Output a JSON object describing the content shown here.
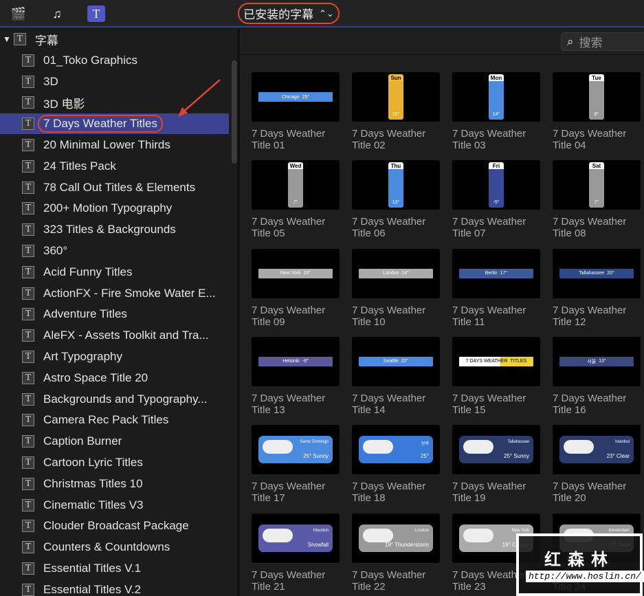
{
  "toolbar": {
    "icons": [
      "clapper-star-icon",
      "music-photo-icon",
      "titles-icon"
    ],
    "selector": "已安装的字幕",
    "selector_icon": "chevron-updown-icon"
  },
  "sidebar": {
    "root": "字幕",
    "items": [
      "01_Toko Graphics",
      "3D",
      "3D 电影",
      "7 Days Weather Titles",
      "20 Minimal Lower Thirds",
      "24 Titles Pack",
      "78 Call Out Titles & Elements",
      "200+ Motion Typography",
      "323 Titles & Backgrounds",
      "360°",
      "Acid Funny Titles",
      "ActionFX - Fire Smoke Water E...",
      "Adventure Titles",
      "AleFX - Assets Toolkit and Tra...",
      "Art Typography",
      "Astro Space Title 20",
      "Backgrounds and Typography...",
      "Camera Rec Pack Titles",
      "Caption Burner",
      "Cartoon Lyric Titles",
      "Christmas Titles 10",
      "Cinematic Titles V3",
      "Clouder Broadcast Package",
      "Counters & Countdowns",
      "Essential Titles V.1",
      "Essential Titles V.2"
    ],
    "selected_index": 3
  },
  "search": {
    "placeholder": "搜索"
  },
  "tiles": [
    {
      "l1": "7 Days Weather",
      "l2": "Title 01",
      "kind": "banner",
      "city": "Chicago",
      "temp": "25°",
      "color": "#4a8be0"
    },
    {
      "l1": "7 Days Weather",
      "l2": "Title 02",
      "kind": "vcard",
      "day": "Sun",
      "temp": "28°",
      "color": "#e8b030"
    },
    {
      "l1": "7 Days Weather",
      "l2": "Title 03",
      "kind": "vcard",
      "day": "Mon",
      "temp": "14°",
      "color": "#4a8be0"
    },
    {
      "l1": "7 Days Weather",
      "l2": "Title 04",
      "kind": "vcard",
      "day": "Tue",
      "temp": "8°",
      "color": "#999999"
    },
    {
      "l1": "7 Days Weather",
      "l2": "Title 05",
      "kind": "vcard",
      "day": "Wed",
      "temp": "7°",
      "color": "#999999"
    },
    {
      "l1": "7 Days Weather",
      "l2": "Title 06",
      "kind": "vcard",
      "day": "Thu",
      "temp": "13°",
      "color": "#4a8be0"
    },
    {
      "l1": "7 Days Weather",
      "l2": "Title 07",
      "kind": "vcard",
      "day": "Fri",
      "temp": "-5°",
      "color": "#3a4a9a"
    },
    {
      "l1": "7 Days Weather",
      "l2": "Title 08",
      "kind": "vcard",
      "day": "Sat",
      "temp": "7°",
      "color": "#999999"
    },
    {
      "l1": "7 Days Weather",
      "l2": "Title 09",
      "kind": "banner",
      "city": "New York",
      "temp": "19°",
      "color": "#aaaaaa"
    },
    {
      "l1": "7 Days Weather",
      "l2": "Title 10",
      "kind": "banner",
      "city": "London",
      "temp": "14°",
      "color": "#aaaaaa"
    },
    {
      "l1": "7 Days Weather",
      "l2": "Title 11",
      "kind": "banner",
      "city": "Berlin",
      "temp": "17°",
      "color": "#3a5a9a"
    },
    {
      "l1": "7 Days Weather",
      "l2": "Title 12",
      "kind": "banner",
      "city": "Tallahassee",
      "temp": "20°",
      "color": "#2a4a8a"
    },
    {
      "l1": "7 Days Weather",
      "l2": "Title 13",
      "kind": "banner",
      "city": "Helsinki",
      "temp": "-9°",
      "color": "#5a5a9a"
    },
    {
      "l1": "7 Days Weather",
      "l2": "Title 14",
      "kind": "banner",
      "city": "Seattle",
      "temp": "22°",
      "color": "#4a8be0"
    },
    {
      "l1": "7 Days Weather",
      "l2": "Title 15",
      "kind": "banner",
      "city": "7 DAYS WEATHER",
      "temp": "TITLES",
      "color": "#f0d030"
    },
    {
      "l1": "7 Days Weather",
      "l2": "Title 16",
      "kind": "banner",
      "city": "서울",
      "temp": "13°",
      "color": "#3a4a7a"
    },
    {
      "l1": "7 Days Weather",
      "l2": "Title 17",
      "kind": "rcard",
      "city": "Santo Domingo",
      "temp": "25° Sunny",
      "color": "#4a8be0"
    },
    {
      "l1": "7 Days Weather",
      "l2": "Title 18",
      "kind": "rcard",
      "city": "방콕",
      "temp": "25°",
      "color": "#3a7ad8"
    },
    {
      "l1": "7 Days Weather",
      "l2": "Title 19",
      "kind": "rcard",
      "city": "Tallahassee",
      "temp": "25° Sunny",
      "color": "#2a3a6a"
    },
    {
      "l1": "7 Days Weather",
      "l2": "Title 20",
      "kind": "rcard",
      "city": "Istanbul",
      "temp": "23° Clear",
      "color": "#2a3a6a"
    },
    {
      "l1": "7 Days Weather",
      "l2": "Title 21",
      "kind": "rcard",
      "city": "Houston",
      "temp": "Snowfall",
      "color": "#5a5aa8"
    },
    {
      "l1": "7 Days Weather",
      "l2": "Title 22",
      "kind": "rcard",
      "city": "London",
      "temp": "19° Thunderstorm",
      "color": "#999999"
    },
    {
      "l1": "7 Days Weather",
      "l2": "Title 23",
      "kind": "rcard",
      "city": "New York",
      "temp": "19° Cloudy",
      "color": "#aaaaaa"
    },
    {
      "l1": "7 Days Weather",
      "l2": "Title 24",
      "kind": "rcard",
      "city": "Amsterdam",
      "temp": "13° Rain",
      "color": "#999999"
    }
  ],
  "watermark": {
    "logo": "红森林",
    "url": "http://www.hoslin.cn/"
  },
  "colors": {
    "selection": "#3c4290",
    "annotation": "#e0442e"
  }
}
